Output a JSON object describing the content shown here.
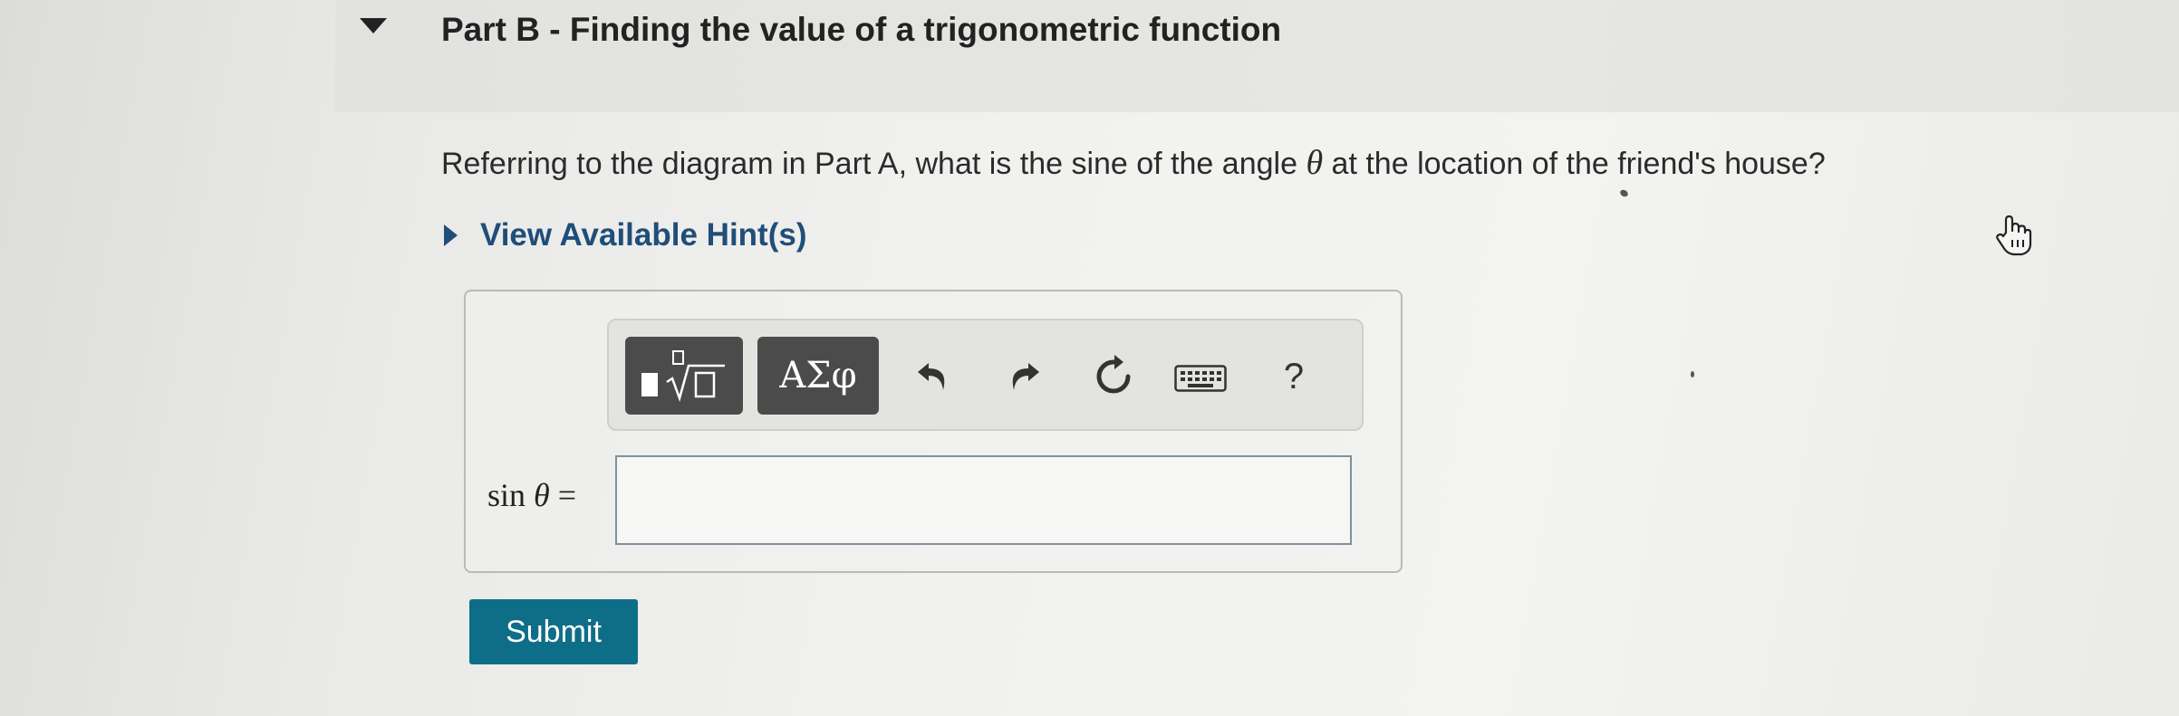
{
  "part": {
    "title": "Part B - Finding the value of a trigonometric function"
  },
  "question": {
    "text_before": "Referring to the diagram in Part A, what is the sine of the angle ",
    "symbol": "θ",
    "text_after": " at the location of the friend's house?"
  },
  "hints": {
    "label": "View Available Hint(s)"
  },
  "toolbar": {
    "symbols_label": "ΑΣφ",
    "help_label": "?",
    "icons": [
      "templates-icon",
      "undo-icon",
      "redo-icon",
      "reset-icon",
      "keyboard-icon"
    ]
  },
  "answer": {
    "label_func": "sin",
    "label_symbol": "θ",
    "label_equals": "=",
    "value": ""
  },
  "submit": {
    "label": "Submit"
  },
  "colors": {
    "submit_bg": "#0f6e87",
    "hint_color": "#1f4e79",
    "toolbar_button_bg": "#4b4b4b"
  }
}
